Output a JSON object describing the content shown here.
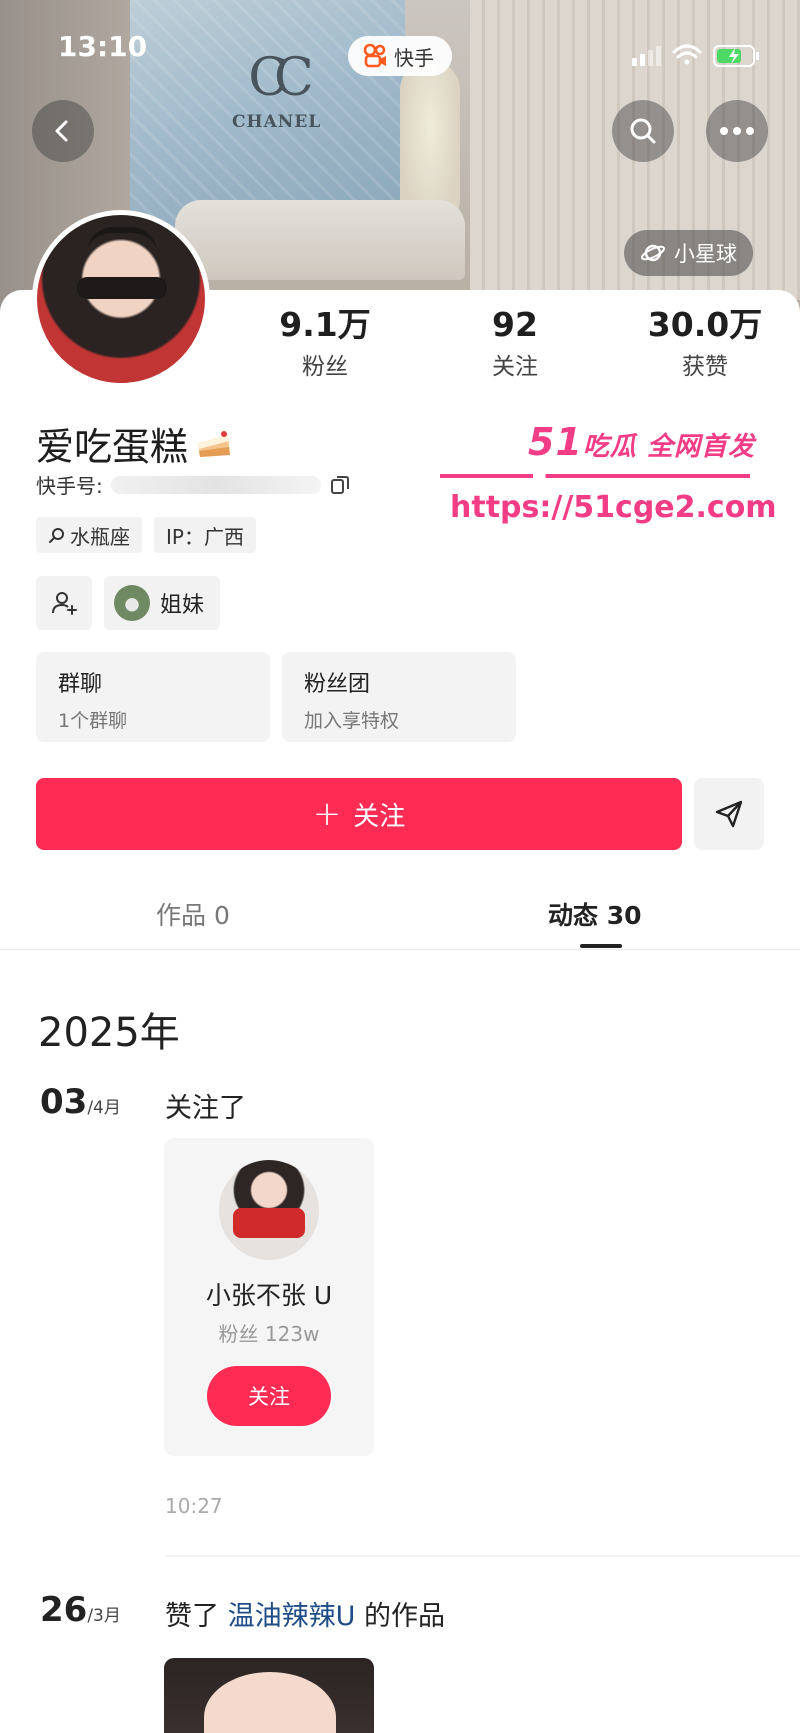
{
  "status_bar": {
    "time": "13:10",
    "app_name": "快手"
  },
  "cover": {
    "brand_text": "CHANEL"
  },
  "planet_button": {
    "label": "小星球"
  },
  "stats": [
    {
      "value": "9.1万",
      "label": "粉丝"
    },
    {
      "value": "92",
      "label": "关注"
    },
    {
      "value": "30.0万",
      "label": "获赞"
    }
  ],
  "profile": {
    "nickname": "爱吃蛋糕",
    "kuaishou_id_label": "快手号:",
    "tags": [
      {
        "icon": "search-icon",
        "label": "水瓶座"
      },
      {
        "icon": "",
        "label": "IP：广西"
      }
    ],
    "relation_label": "姐妹"
  },
  "groups": [
    {
      "title": "群聊",
      "subtitle": "1个群聊"
    },
    {
      "title": "粉丝团",
      "subtitle": "加入享特权"
    }
  ],
  "actions": {
    "follow_label": "关注"
  },
  "tabs": [
    {
      "label": "作品 0"
    },
    {
      "label": "动态 30"
    }
  ],
  "feed": {
    "year": "2025年",
    "entries": [
      {
        "day": "03",
        "month": "/4月",
        "action": "关注了",
        "card": {
          "name": "小张不张 U",
          "fans": "粉丝 123w",
          "button": "关注"
        },
        "time": "10:27"
      },
      {
        "day": "26",
        "month": "/3月",
        "prefix": "赞了",
        "link": "温油辣辣U",
        "suffix": "的作品"
      }
    ]
  },
  "watermark": {
    "line1": "51",
    "line1_rest": "吃瓜 全网首发",
    "url": "https://51cge2.com"
  },
  "colors": {
    "accent": "#fe2c55",
    "link": "#1e4c86",
    "watermark": "#f23c86"
  }
}
